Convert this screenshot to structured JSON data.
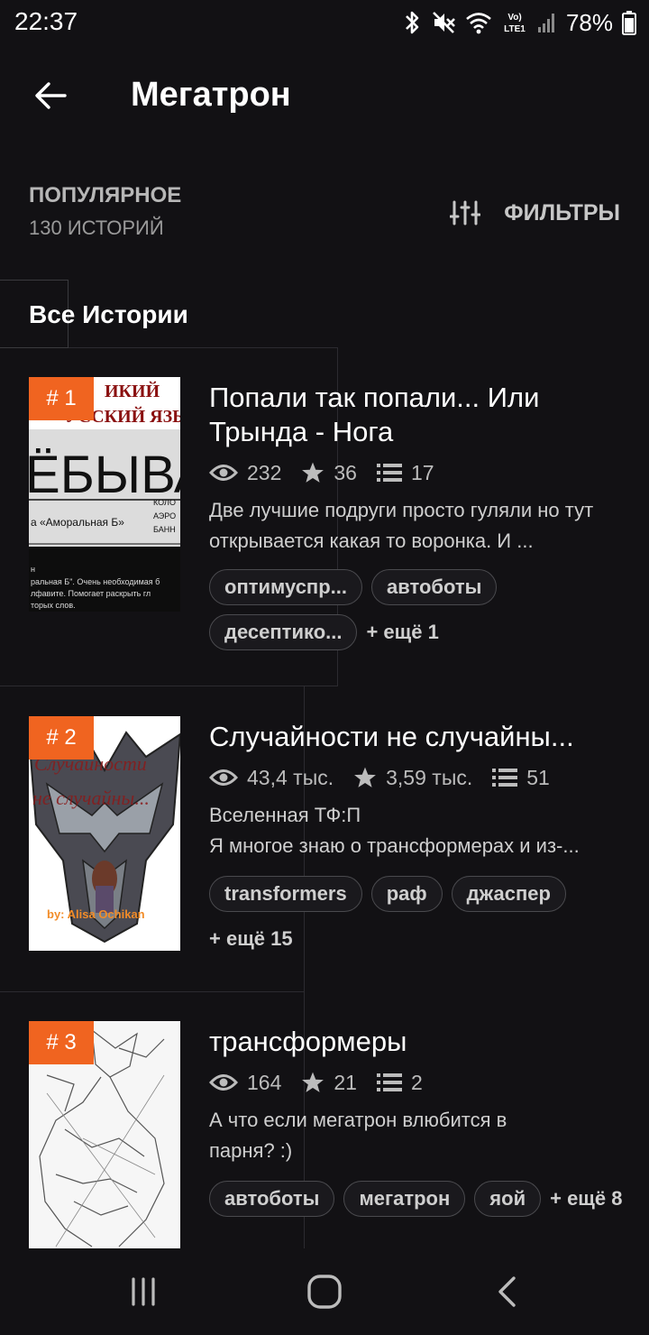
{
  "status": {
    "time": "22:37",
    "battery": "78%",
    "network_label_top": "Vo)",
    "network_label_bottom": "LTE1"
  },
  "header": {
    "title": "Мегатрон",
    "back_icon": "arrow-left-icon"
  },
  "sort": {
    "label": "ПОПУЛЯРНОЕ",
    "count": "130 ИСТОРИЙ",
    "filters_label": "ФИЛЬТРЫ"
  },
  "section": {
    "title": "Все Истории"
  },
  "colors": {
    "background": "#121114",
    "accent": "#f06420",
    "tag_border": "#4a4a4e"
  },
  "stories": [
    {
      "rank": "# 1",
      "title": "Попали так попали... Или Трында - Нога",
      "views": "232",
      "votes": "36",
      "parts": "17",
      "description": "Две лучшие подруги просто гуляли но тут открывается какая то воронка. И ...",
      "tags": [
        "оптимуспр...",
        "автоботы",
        "десептико..."
      ],
      "more_tags": "+ ещё 1",
      "cover_text": {
        "top1": "ИКИЙ",
        "top2": "УССКИЙ ЯЗЫК!",
        "big": "ЁБЫВА",
        "quote": "а «Аморальная Б»",
        "side1": "КОЛО",
        "side2": "АЭРО",
        "side3": "БАНН",
        "foot1": "н",
        "foot2": "ральная Б\". Очень необходимая б",
        "foot3": "лфавите. Помогает раскрыть гл",
        "foot4": "торых слов."
      }
    },
    {
      "rank": "# 2",
      "title": "Случайности не случайны...",
      "views": "43,4 тыс.",
      "votes": "3,59 тыс.",
      "parts": "51",
      "description_line1": "Вселенная ТФ:П",
      "description_line2": "Я многое знаю о трансформерах и из-...",
      "tags": [
        "transformers",
        "раф",
        "джаспер"
      ],
      "more_tags": "+ ещё 15",
      "cover_text": {
        "line1": "Случайности",
        "line2": "не случайны...",
        "byline": "by: Alisa Ochikan"
      }
    },
    {
      "rank": "# 3",
      "title": "трансформеры",
      "views": "164",
      "votes": "21",
      "parts": "2",
      "description": "А что если мегатрон влюбится в парня? :)",
      "tags": [
        "автоботы",
        "мегатрон",
        "яой"
      ],
      "more_tags": "+ ещё 8"
    }
  ],
  "navbar": {
    "recents_icon": "recents-icon",
    "home_icon": "home-icon",
    "back_icon": "nav-back-icon"
  }
}
